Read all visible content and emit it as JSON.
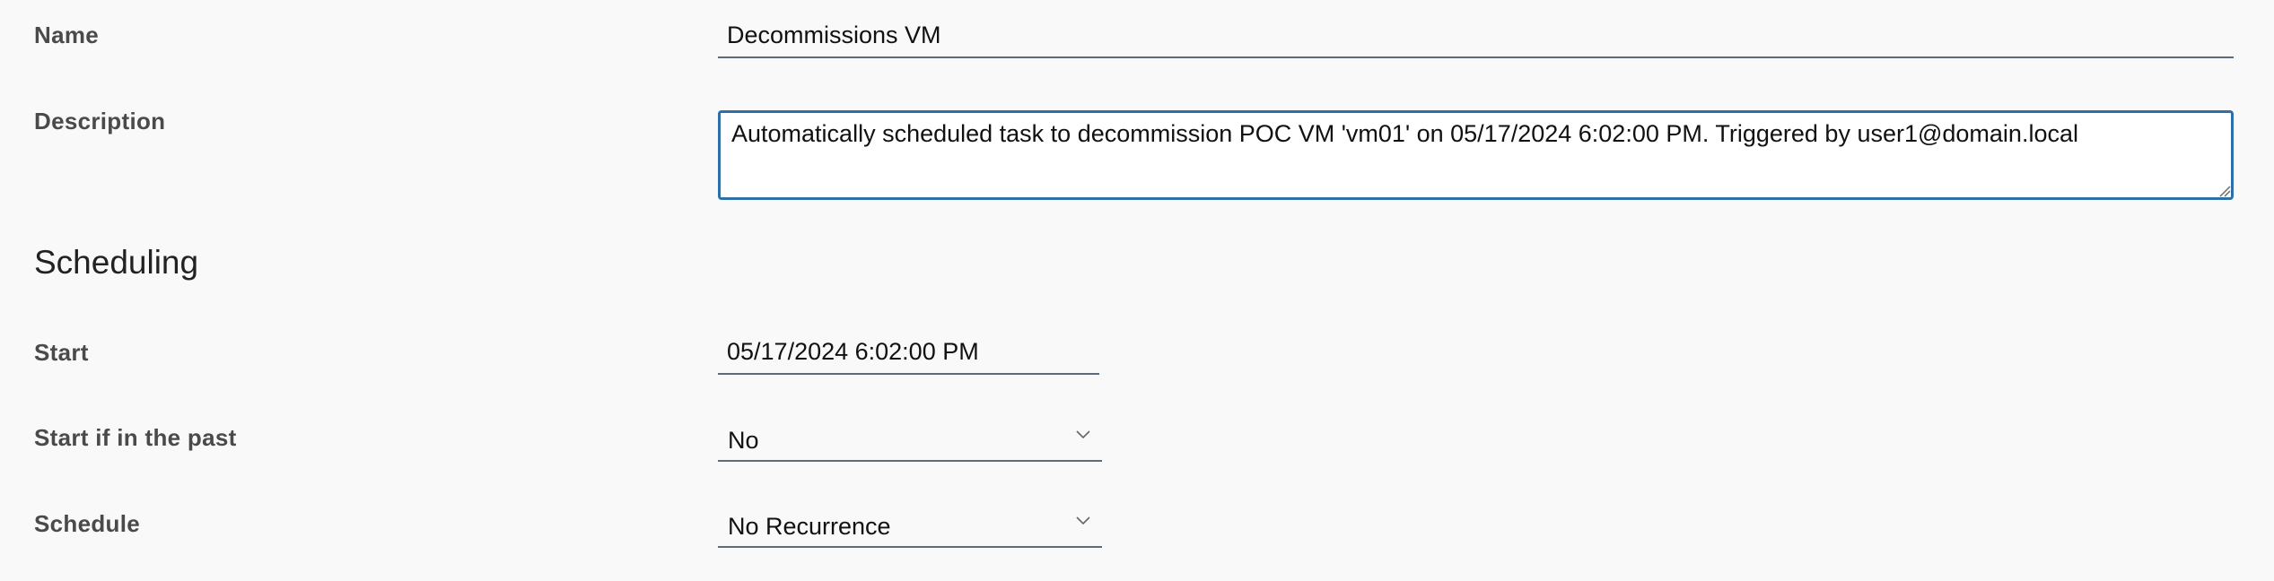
{
  "form": {
    "name": {
      "label": "Name",
      "value": "Decommissions VM"
    },
    "description": {
      "label": "Description",
      "value": "Automatically scheduled task to decommission POC VM 'vm01' on 05/17/2024 6:02:00 PM. Triggered by user1@domain.local"
    },
    "scheduling": {
      "heading": "Scheduling",
      "start": {
        "label": "Start",
        "value": "05/17/2024 6:02:00 PM"
      },
      "start_if_past": {
        "label": "Start if in the past",
        "value": "No"
      },
      "schedule": {
        "label": "Schedule",
        "value": "No Recurrence"
      }
    }
  },
  "icons": {
    "dropdown": "chevron-down-icon",
    "textarea_resize": "resize-grip-icon"
  },
  "colors": {
    "focus_border": "#2f6fa8",
    "underline": "#5c6b77",
    "background": "#f9f9f9"
  }
}
